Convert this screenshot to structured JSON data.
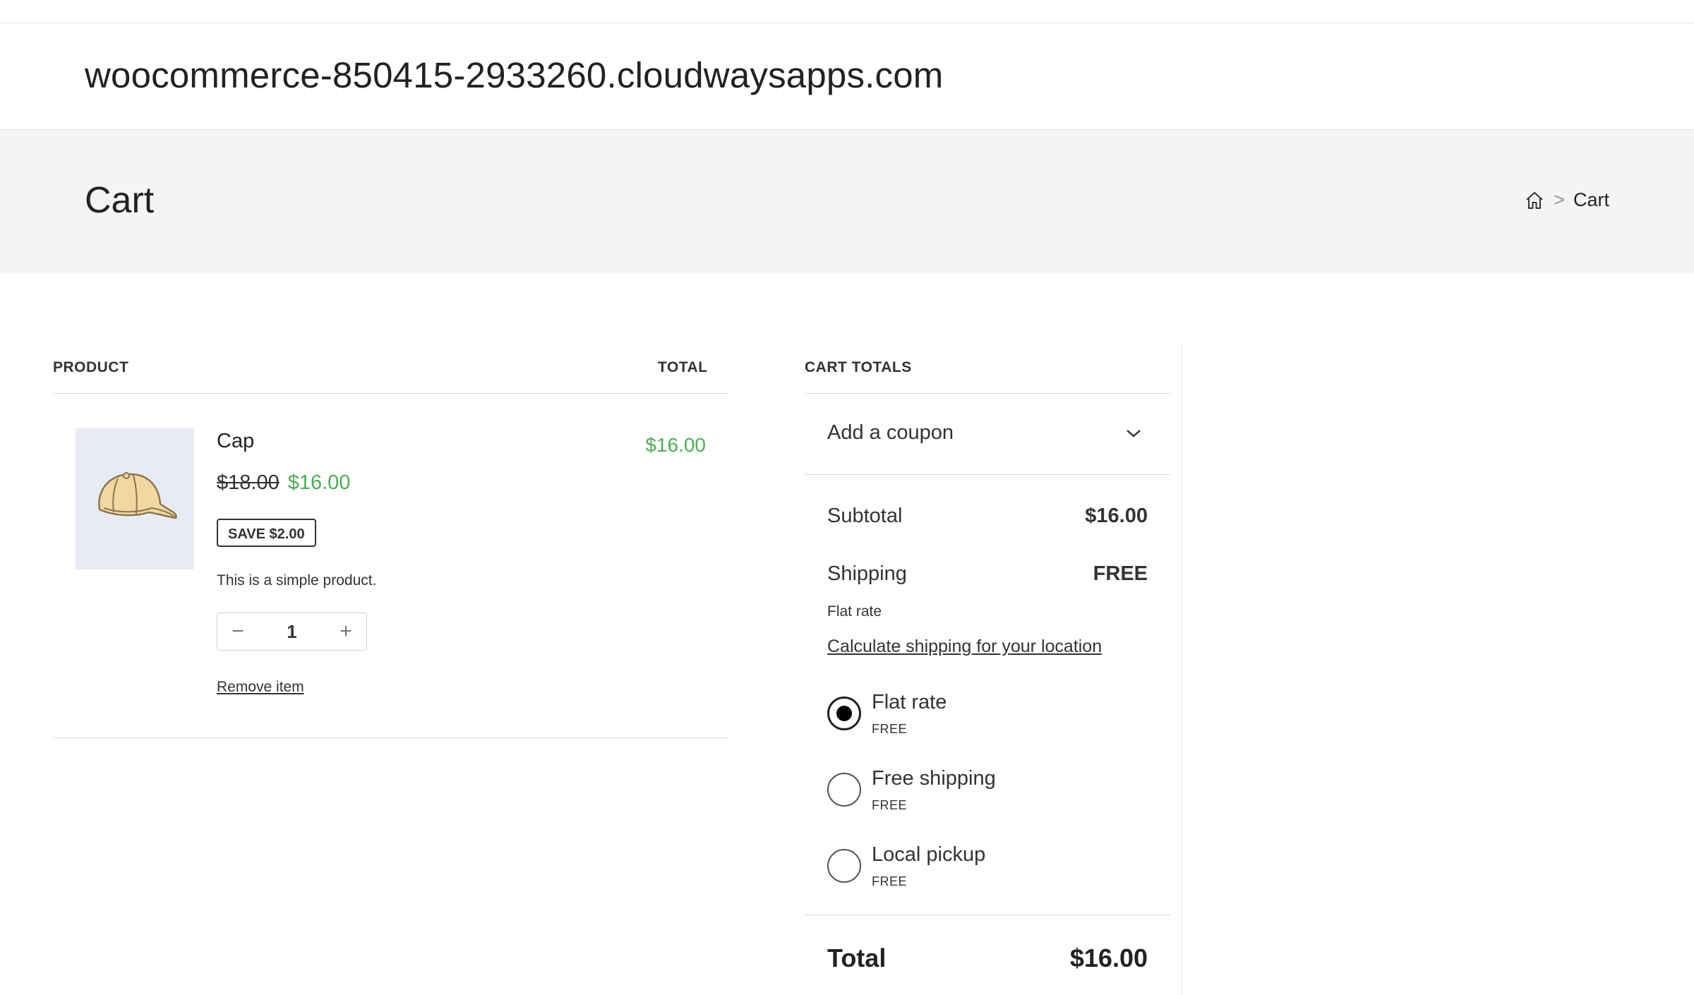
{
  "site": {
    "title": "woocommerce-850415-2933260.cloudwaysapps.com"
  },
  "page": {
    "title": "Cart",
    "breadcrumb": {
      "home_icon": "home-icon",
      "separator": ">",
      "current": "Cart"
    }
  },
  "cart_table": {
    "headers": {
      "product": "PRODUCT",
      "total": "TOTAL"
    },
    "items": [
      {
        "name": "Cap",
        "image_icon": "cap-icon",
        "regular_price": "$18.00",
        "sale_price": "$16.00",
        "save_badge": "SAVE $2.00",
        "description": "This is a simple product.",
        "quantity": "1",
        "decrease_symbol": "−",
        "increase_symbol": "+",
        "remove_label": "Remove item",
        "line_total": "$16.00"
      }
    ]
  },
  "totals": {
    "heading": "CART TOTALS",
    "coupon_label": "Add a coupon",
    "coupon_icon": "chevron-down-icon",
    "subtotal_label": "Subtotal",
    "subtotal_value": "$16.00",
    "shipping_label": "Shipping",
    "shipping_value": "FREE",
    "shipping_method": "Flat rate",
    "calc_link": "Calculate shipping for your location",
    "options": [
      {
        "name": "Flat rate",
        "price": "FREE",
        "selected": true
      },
      {
        "name": "Free shipping",
        "price": "FREE",
        "selected": false
      },
      {
        "name": "Local pickup",
        "price": "FREE",
        "selected": false
      }
    ],
    "total_label": "Total",
    "total_value": "$16.00"
  },
  "colors": {
    "sale_green": "#4caf50",
    "page_header_bg": "#f4f4f4",
    "image_bg": "#e8ecf2"
  }
}
